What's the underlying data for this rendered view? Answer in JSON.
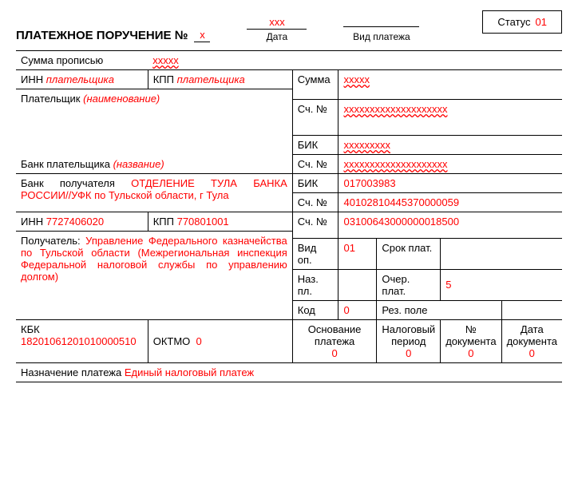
{
  "header": {
    "title_prefix": "ПЛАТЕЖНОЕ ПОРУЧЕНИЕ №",
    "number": "х",
    "date_value": "ххх",
    "date_label": "Дата",
    "payment_type_label": "Вид платежа",
    "status_label": "Статус",
    "status_value": "01"
  },
  "sum_words": {
    "label": "Сумма прописью",
    "value": "ххххх"
  },
  "payer": {
    "inn_label": "ИНН",
    "inn_value": "плательщика",
    "kpp_label": "КПП",
    "kpp_value": "плательщика",
    "payer_label": "Плательщик",
    "payer_value": "(наименование)",
    "bank_label": "Банк плательщика",
    "bank_value": "(название)"
  },
  "recipient_bank": {
    "text_label": "Банк получателя",
    "text_value": "ОТДЕЛЕНИЕ ТУЛА БАНКА РОССИИ//УФК по Тульской области, г Тула"
  },
  "recipient": {
    "inn_label": "ИНН",
    "inn_value": "7727406020",
    "kpp_label": "КПП",
    "kpp_value": "770801001",
    "payee_label": "Получатель:",
    "payee_value": "Управление Федерального казначейства по Тульской области (Межрегиональная инспекция Федеральной налоговой службы по управлению долгом)"
  },
  "right": {
    "sum_label": "Сумма",
    "sum_value": "ххххх",
    "sch_label": "Сч. №",
    "sch1_value": "хххххххххххххххххххх",
    "bik_label": "БИК",
    "bik1_value": "ххххххххх",
    "sch2_value": "хххххххххххххххххххх",
    "bik2_value": "017003983",
    "sch3_value": "40102810445370000059",
    "sch4_value": "03100643000000018500",
    "vid_op_label": "Вид оп.",
    "vid_op_value": "01",
    "srok_label": "Срок плат.",
    "naz_pl_label": "Наз. пл.",
    "ocher_label": "Очер. плат.",
    "ocher_value": "5",
    "kod_label": "Код",
    "kod_value": "0",
    "rez_label": "Рез. поле"
  },
  "bottom": {
    "kbk_label": "КБК",
    "kbk_value": "18201061201010000510",
    "oktmo_label": "ОКТМО",
    "oktmo_value": "0",
    "osnov_label": "Основание платежа",
    "osnov_value": "0",
    "nalog_label": "Налоговый период",
    "nalog_value": "0",
    "docnum_label": "№ документа",
    "docnum_value": "0",
    "docdate_label": "Дата документа",
    "docdate_value": "0"
  },
  "purpose": {
    "label": "Назначение платежа",
    "value": "Единый налоговый платеж"
  }
}
